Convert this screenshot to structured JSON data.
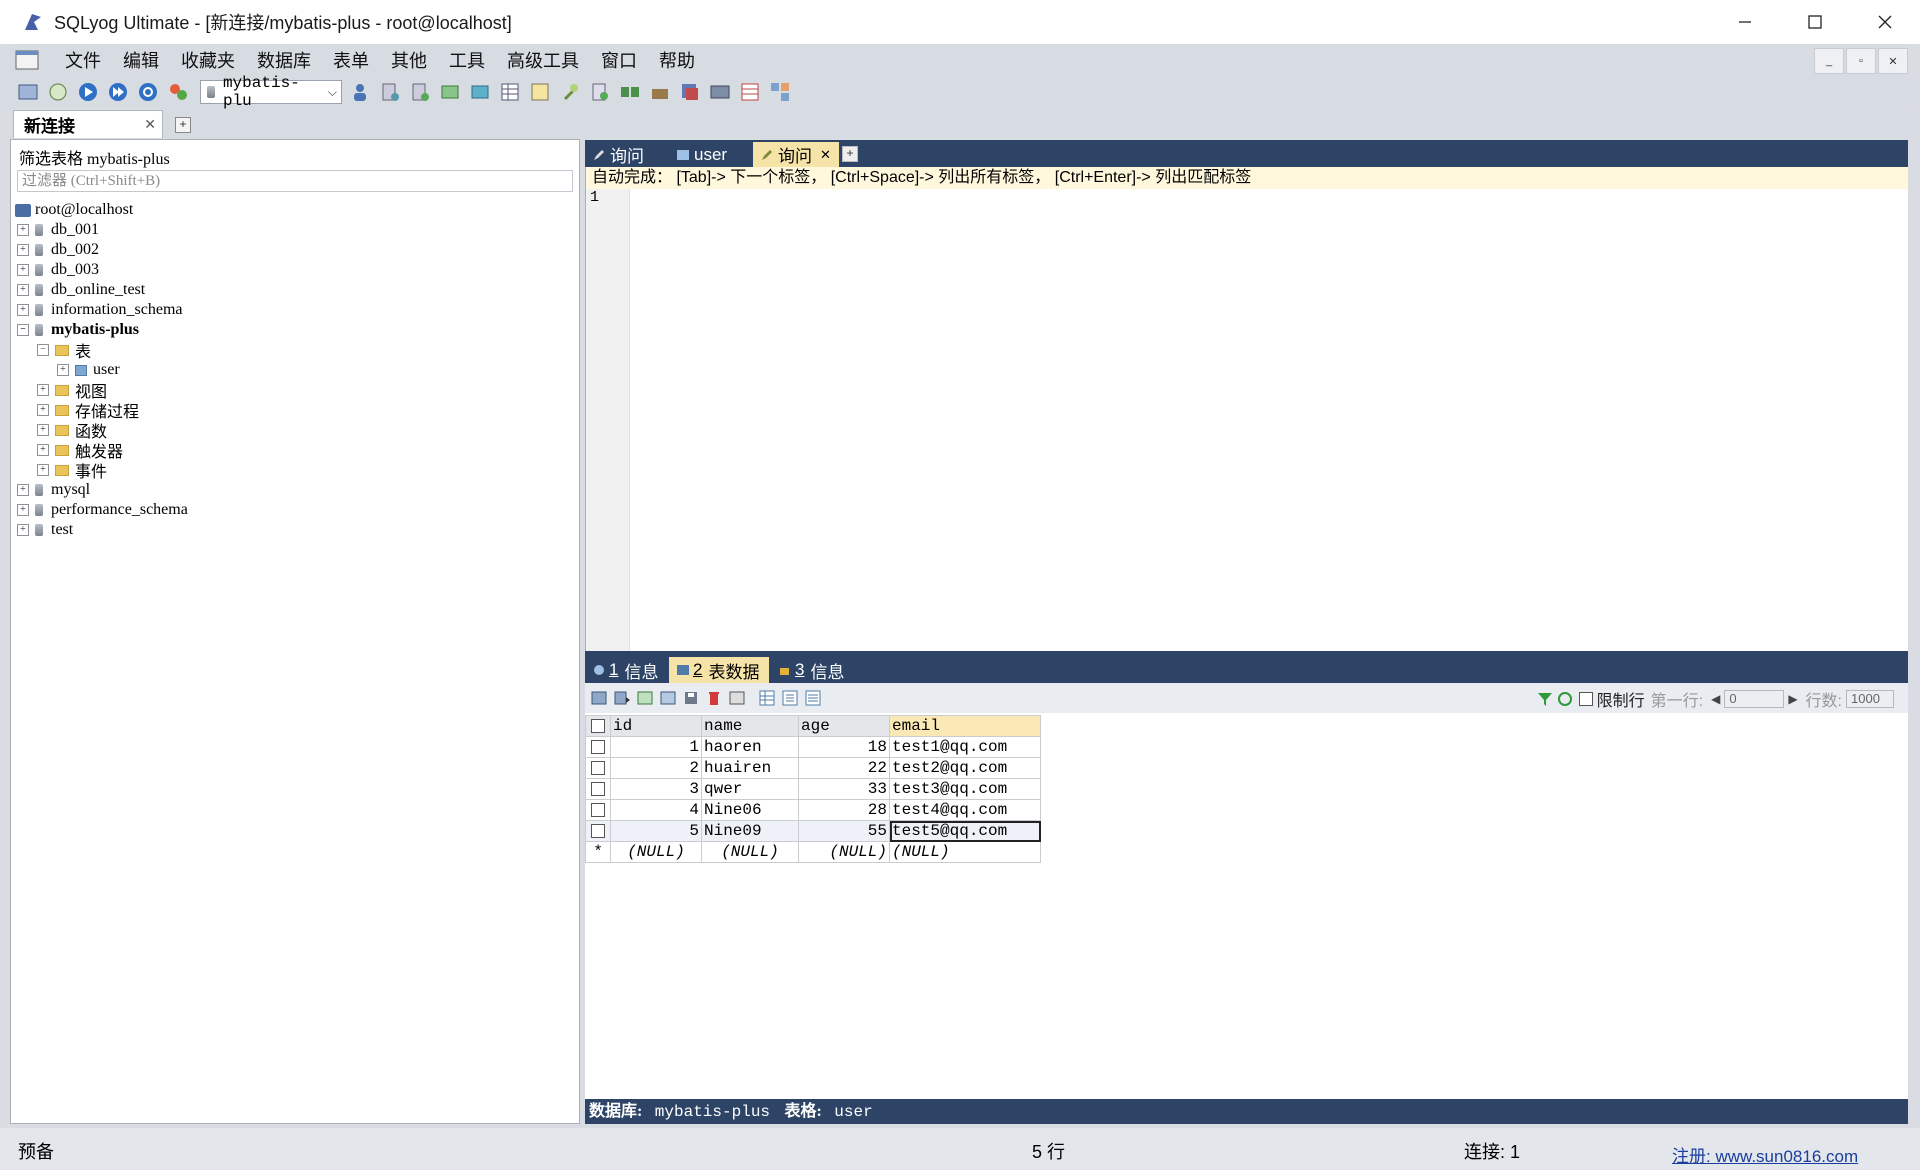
{
  "window": {
    "title": "SQLyog Ultimate - [新连接/mybatis-plus - root@localhost]"
  },
  "menu": [
    "文件",
    "编辑",
    "收藏夹",
    "数据库",
    "表单",
    "其他",
    "工具",
    "高级工具",
    "窗口",
    "帮助"
  ],
  "toolbar": {
    "db_selected": "mybatis-plu"
  },
  "connection_tab": {
    "label": "新连接"
  },
  "object_browser": {
    "filter_label": "筛选表格 mybatis-plus",
    "filter_placeholder": "过滤器 (Ctrl+Shift+B)",
    "server": "root@localhost",
    "databases": [
      "db_001",
      "db_002",
      "db_003",
      "db_online_test",
      "information_schema",
      "mybatis-plus",
      "mysql",
      "performance_schema",
      "test"
    ],
    "mybatis_children": [
      "表",
      "视图",
      "存储过程",
      "函数",
      "触发器",
      "事件"
    ],
    "table_user": "user"
  },
  "query_tabs": [
    "询问",
    "user",
    "询问"
  ],
  "editor": {
    "hint": "自动完成： [Tab]-> 下一个标签， [Ctrl+Space]-> 列出所有标签， [Ctrl+Enter]-> 列出匹配标签",
    "line_no": "1"
  },
  "result_tabs": [
    {
      "num": "1",
      "label": "信息"
    },
    {
      "num": "2",
      "label": "表数据"
    },
    {
      "num": "3",
      "label": "信息"
    }
  ],
  "limit": {
    "checkbox_label": "限制行",
    "first_row_label": "第一行:",
    "first_row_value": "0",
    "rows_label": "行数:",
    "rows_value": "1000"
  },
  "grid": {
    "columns": [
      "id",
      "name",
      "age",
      "email"
    ],
    "rows": [
      [
        "1",
        "haoren",
        "18",
        "test1@qq.com"
      ],
      [
        "2",
        "huairen",
        "22",
        "test2@qq.com"
      ],
      [
        "3",
        "qwer",
        "33",
        "test3@qq.com"
      ],
      [
        "4",
        "Nine06",
        "28",
        "test4@qq.com"
      ],
      [
        "5",
        "Nine09",
        "55",
        "test5@qq.com"
      ]
    ],
    "null_text": "(NULL)",
    "new_row_marker": "*"
  },
  "result_status": {
    "db_label": "数据库:",
    "db": "mybatis-plus",
    "table_label": "表格:",
    "table": "user"
  },
  "statusbar": {
    "left": "预备",
    "rows": "5 行",
    "conn": "连接: 1",
    "register": "注册:  www.sun0816.com"
  }
}
